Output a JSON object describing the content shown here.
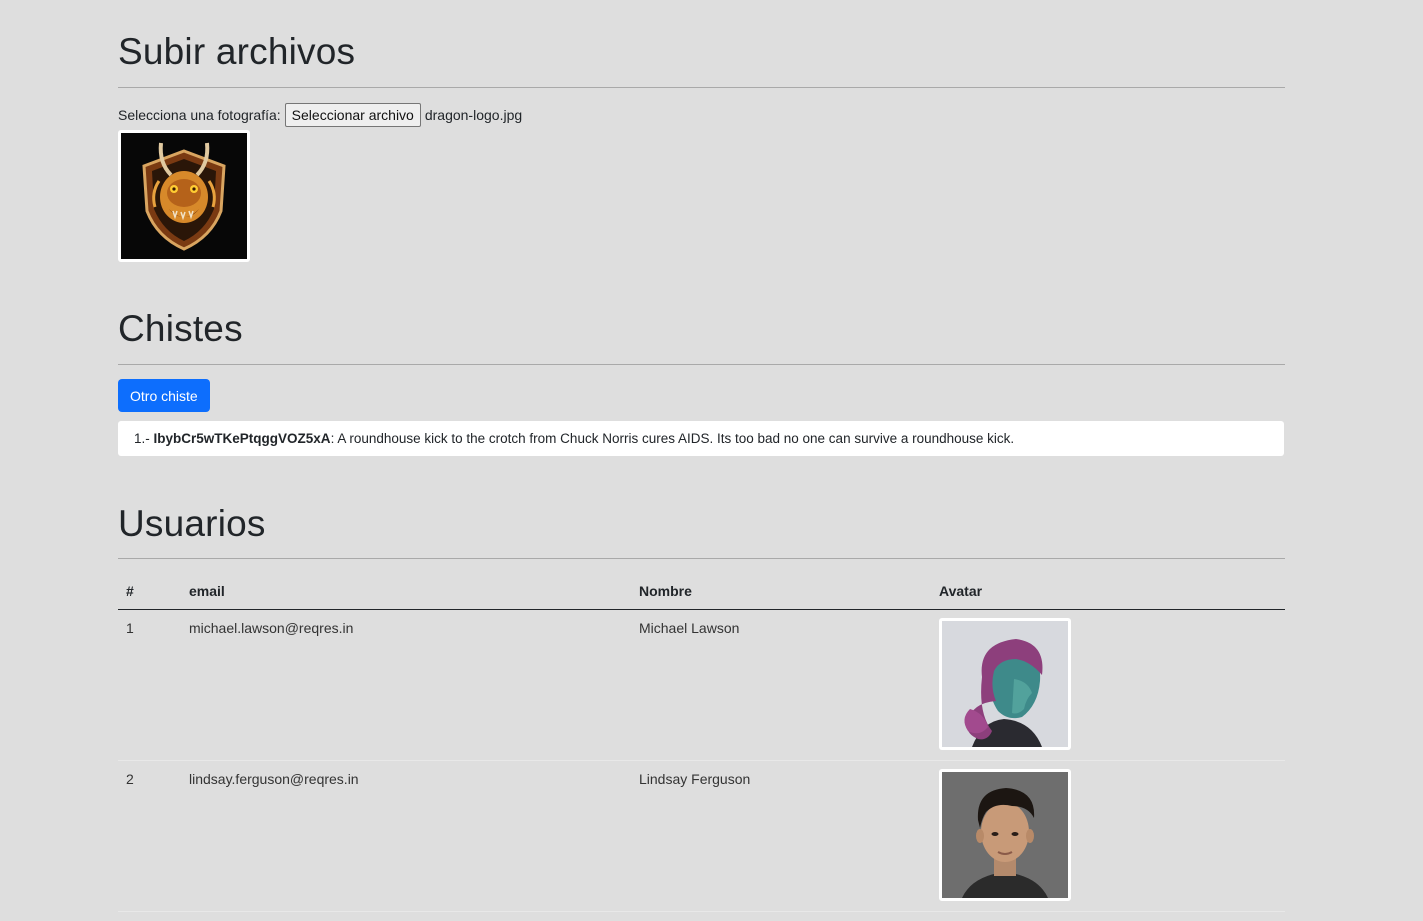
{
  "upload": {
    "title": "Subir archivos",
    "label": "Selecciona una fotografía:",
    "button_label": "Seleccionar archivo",
    "file_name": "dragon-logo.jpg",
    "preview_icon": "dragon-logo-image"
  },
  "jokes": {
    "title": "Chistes",
    "button_label": "Otro chiste",
    "items": [
      {
        "index": "1.-",
        "id": "IbybCr5wTKePtqggVOZ5xA",
        "text": ": A roundhouse kick to the crotch from Chuck Norris cures AIDS. Its too bad no one can survive a roundhouse kick."
      }
    ]
  },
  "users": {
    "title": "Usuarios",
    "columns": [
      "#",
      "email",
      "Nombre",
      "Avatar"
    ],
    "rows": [
      {
        "num": "1",
        "email": "michael.lawson@reqres.in",
        "name": "Michael Lawson",
        "avatar": "avatar-portrait-woman"
      },
      {
        "num": "2",
        "email": "lindsay.ferguson@reqres.in",
        "name": "Lindsay Ferguson",
        "avatar": "avatar-portrait-man"
      }
    ]
  },
  "colors": {
    "background": "#dedede",
    "primary_button": "#0d6efd"
  }
}
